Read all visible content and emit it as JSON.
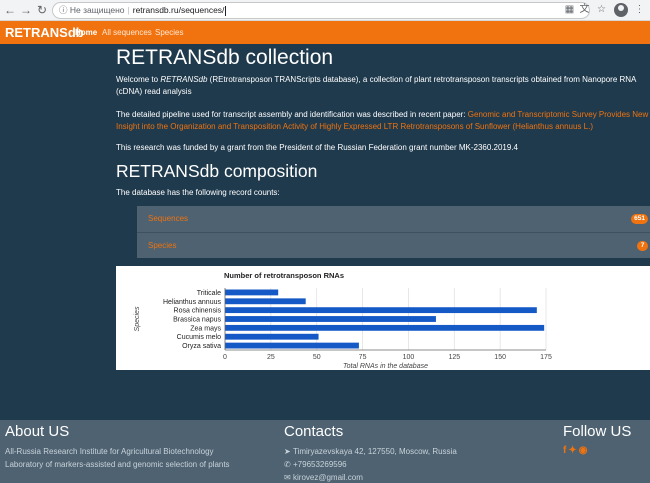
{
  "browser": {
    "security_text": "Не защищено",
    "url": "retransdb.ru/sequences/"
  },
  "navbar": {
    "brand": "RETRANSdb",
    "links": [
      "Home",
      "All sequences",
      "Species"
    ]
  },
  "main": {
    "title": "RETRANSdb collection",
    "intro_1": "Welcome to ",
    "intro_name": "RETRANSdb",
    "intro_2": " (REtrotransposon TRANScripts database), a collection of plant retrotransposon transcripts obtained from Nanopore RNA (cDNA) read analysis",
    "pipeline_text": "The detailed pipeline used for transcript assembly and identification was described in recent paper: ",
    "paper_link": "Genomic and Transcriptomic Survey Provides New Insight into the Organization and Transposition Activity of Highly Expressed LTR Retrotransposons of Sunflower (Helianthus annuus L.)",
    "grant_text": "This research was funded by a grant from the President of the Russian Federation grant number MK-2360.2019.4",
    "composition_title": "RETRANSdb composition",
    "composition_intro": "The database has the following record counts:",
    "records": [
      {
        "label": "Sequences",
        "count": "651"
      },
      {
        "label": "Species",
        "count": "7"
      }
    ]
  },
  "chart_data": {
    "type": "bar",
    "orientation": "horizontal",
    "title": "Number of retrotransposon RNAs",
    "xlabel": "Total RNAs in the database",
    "ylabel": "Species",
    "categories": [
      "Triticale",
      "Helianthus annuus",
      "Rosa chinensis",
      "Brassica napus",
      "Zea mays",
      "Cucumis melo",
      "Oryza sativa"
    ],
    "values": [
      29,
      44,
      170,
      115,
      174,
      51,
      73
    ],
    "xlim": [
      0,
      175
    ],
    "xticks": [
      0,
      25,
      50,
      75,
      100,
      125,
      150,
      175
    ],
    "bar_color": "#1559c7",
    "grid": true,
    "legend": "none"
  },
  "footer": {
    "about_title": "About US",
    "about_lines": [
      "All-Russia Research Institute for Agricultural Biotechnology",
      "Laboratory of markers-assisted and genomic selection of plants"
    ],
    "contacts_title": "Contacts",
    "address": "Timiryazevskaya 42, 127550, Moscow, Russia",
    "phone": "+79653269596",
    "email": "kirovez@gmail.com",
    "follow_title": "Follow US",
    "social_icons": [
      "facebook-icon",
      "twitter-icon",
      "github-icon"
    ]
  },
  "colors": {
    "brand_orange": "#f0730f",
    "page_background": "#1f3a4d",
    "panel_background": "#4e6271"
  }
}
